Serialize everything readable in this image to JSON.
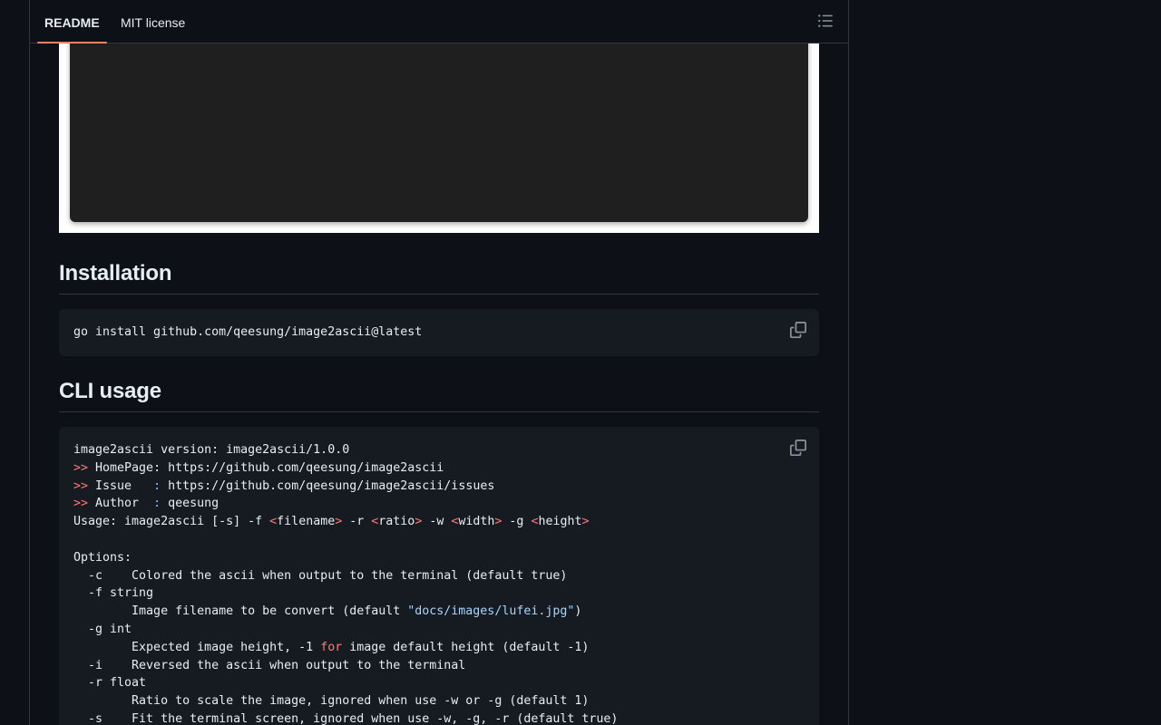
{
  "tabs": [
    {
      "label": "README",
      "active": true
    },
    {
      "label": "MIT license",
      "active": false
    }
  ],
  "outline_icon": "list-unordered-icon",
  "copy_icon": "copy-icon",
  "sections": {
    "installation": {
      "heading": "Installation",
      "code": "go install github.com/qeesung/image2ascii@latest"
    },
    "cli_usage": {
      "heading": "CLI usage",
      "lines": {
        "l1": "image2ascii version: image2ascii/1.0.0",
        "l2_prompt": ">>",
        "l2_text": " HomePage: https://github.com/qeesung/image2ascii",
        "l3_prompt": ">>",
        "l3_text": " Issue   ",
        "l3_colon": ":",
        "l3_rest": " https://github.com/qeesung/image2ascii/issues",
        "l4_prompt": ">>",
        "l4_text": " Author  ",
        "l4_colon": ":",
        "l4_rest": " qeesung",
        "l5_a": "Usage: image2ascii [-s] -f ",
        "l5_lt1": "<",
        "l5_b": "filename",
        "l5_gt1": ">",
        "l5_c": " -r ",
        "l5_lt2": "<",
        "l5_d": "ratio",
        "l5_gt2": ">",
        "l5_e": " -w ",
        "l5_lt3": "<",
        "l5_f": "width",
        "l5_gt3": ">",
        "l5_g": " -g ",
        "l5_lt4": "<",
        "l5_h": "height",
        "l5_gt4": ">",
        "l7": "Options:",
        "l8": "  -c    Colored the ascii when output to the terminal (default true)",
        "l9": "  -f string",
        "l10_a": "        Image filename to be convert (default ",
        "l10_str": "\"docs/images/lufei.jpg\"",
        "l10_b": ")",
        "l11": "  -g int",
        "l12_a": "        Expected image height, -1 ",
        "l12_kw": "for",
        "l12_b": " image default height (default -1)",
        "l13": "  -i    Reversed the ascii when output to the terminal",
        "l14": "  -r float",
        "l15": "        Ratio to scale the image, ignored when use -w or -g (default 1)",
        "l16": "  -s    Fit the terminal screen, ignored when use -w, -g, -r (default true)"
      }
    }
  }
}
